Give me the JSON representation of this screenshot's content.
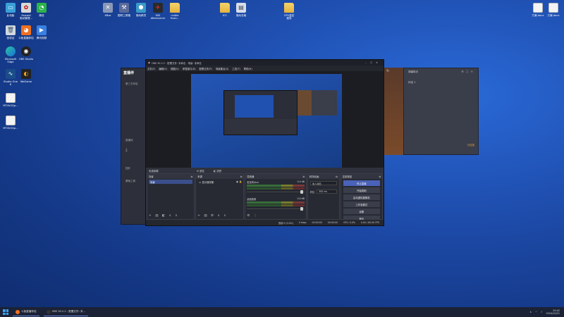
{
  "desktop_icons_left": [
    {
      "label": "此电脑"
    },
    {
      "label": "Huawei\n驱动管理..."
    },
    {
      "label": "微信"
    },
    {
      "label": "回收站"
    },
    {
      "label": "斗鱼直播伴侣"
    },
    {
      "label": "腾讯视频"
    },
    {
      "label": "Microsoft\nEdge"
    },
    {
      "label": "OBS Studio"
    },
    {
      "label": "Studio One\n6"
    },
    {
      "label": "WeGame"
    },
    {
      "label": "MTVkOQp..."
    },
    {
      "label": "MTVkOQp..."
    }
  ],
  "desktop_icons_top": [
    {
      "label": "XBox"
    },
    {
      "label": "图吧工具箱"
    },
    {
      "label": "驱动精灵"
    },
    {
      "label": "MSI\nAfterburner"
    },
    {
      "label": "nvidia\nfrosh..."
    },
    {
      "label": "ICC"
    },
    {
      "label": "驱动总裁"
    },
    {
      "label": "CPU温控\n程序"
    },
    {
      "label": "方案.docx"
    },
    {
      "label": "方案.docx"
    }
  ],
  "bg_app": {
    "logo": "直播伴",
    "rows": [
      "第三方伴侣",
      "",
      "",
      "",
      "",
      "",
      "直播间",
      "",
      "",
      "",
      "插件",
      "",
      "",
      "",
      "基础工具"
    ]
  },
  "side_panel": {
    "title": "弹幕助手",
    "sub": "伴侣 1",
    "link": "已连接"
  },
  "obs": {
    "title": "OBS 30.2.2 - 配置文件: 未命名 - 场景: 未命名",
    "menu": [
      "文件(F)",
      "编辑(E)",
      "视图(V)",
      "停靠窗口(D)",
      "配置文件(P)",
      "场景集合(S)",
      "工具(T)",
      "帮助(H)"
    ],
    "toolbar": {
      "left": "未选择源",
      "gear": "⚙ 属性",
      "filter": "◧ 滤镜"
    },
    "docks": {
      "scenes": {
        "title": "场景",
        "items": [
          "场景"
        ]
      },
      "sources": {
        "title": "来源",
        "items": [
          "显示器采集"
        ]
      },
      "mixer": {
        "title": "混音器",
        "channels": [
          {
            "name": "麦克风/Aux",
            "db": "0.0 dB"
          },
          {
            "name": "桌面音频",
            "db": "0.0 dB"
          }
        ]
      },
      "transitions": {
        "title": "转场动画",
        "type": "淡入淡出",
        "duration_label": "时长",
        "duration": "300 ms"
      },
      "controls": {
        "title": "控制按钮",
        "buttons": [
          "停止直播",
          "开始录制",
          "启动虚拟摄像机",
          "工作室模式",
          "设置",
          "退出"
        ]
      }
    },
    "status": [
      "丢帧 0 (0.0%)",
      "0 kbps",
      "00:00:00",
      "00:00:00",
      "CPU: 0.0%",
      "0.00 / 60.00 FPS"
    ]
  },
  "taskbar": {
    "items": [
      "斗鱼直播伴侣",
      "OBS 30.2.2 - 配置文件: 未..."
    ],
    "time": "20:42",
    "date": "2024/10/21"
  }
}
